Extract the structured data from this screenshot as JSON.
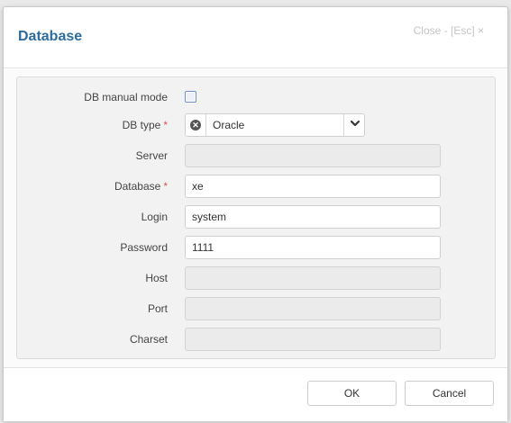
{
  "dialog": {
    "title": "Database",
    "close_label": "Close - [Esc] ×"
  },
  "form": {
    "manual_mode": {
      "label": "DB manual mode",
      "checked": false
    },
    "db_type": {
      "label": "DB type",
      "required_mark": "*",
      "value": "Oracle",
      "icon": "circle-x-icon",
      "arrow": "chevron-down-icon"
    },
    "server": {
      "label": "Server",
      "value": "",
      "disabled": true
    },
    "database": {
      "label": "Database",
      "required_mark": "*",
      "value": "xe"
    },
    "login": {
      "label": "Login",
      "value": "system"
    },
    "password": {
      "label": "Password",
      "value": "1111"
    },
    "host": {
      "label": "Host",
      "value": "",
      "disabled": true
    },
    "port": {
      "label": "Port",
      "value": "",
      "disabled": true
    },
    "charset": {
      "label": "Charset",
      "value": "",
      "disabled": true
    }
  },
  "footer": {
    "ok_label": "OK",
    "cancel_label": "Cancel"
  },
  "colors": {
    "title": "#2d6d9e",
    "required": "#d9534f",
    "disabled_field": "#ebebeb"
  }
}
